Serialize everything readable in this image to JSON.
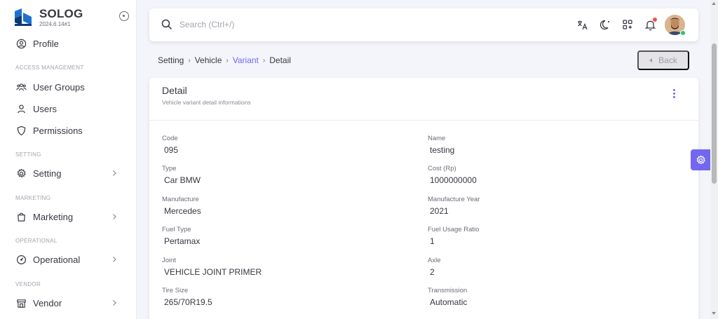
{
  "brand": {
    "name": "SOLOG",
    "version": "2024.6.14#1"
  },
  "sidebar": {
    "profile": "Profile",
    "sections": {
      "access": "ACCESS MANAGEMENT",
      "setting": "SETTING",
      "marketing": "MARKETING",
      "operational": "OPERATIONAL",
      "vendor": "VENDOR"
    },
    "items": {
      "user_groups": "User Groups",
      "users": "Users",
      "permissions": "Permissions",
      "setting": "Setting",
      "marketing": "Marketing",
      "operational": "Operational",
      "vendor": "Vendor"
    }
  },
  "topbar": {
    "search_placeholder": "Search (Ctrl+/)",
    "icons": [
      "translate-icon",
      "theme-toggle-icon",
      "shortcuts-icon",
      "notification-icon"
    ]
  },
  "breadcrumb": [
    "Setting",
    "Vehicle",
    "Variant",
    "Detail"
  ],
  "back_label": "Back",
  "card": {
    "title": "Detail",
    "subtitle": "Vehicle variant detail informations"
  },
  "fields": [
    {
      "label": "Code",
      "value": "095"
    },
    {
      "label": "Name",
      "value": "testing"
    },
    {
      "label": "Type",
      "value": "Car BMW"
    },
    {
      "label": "Cost (Rp)",
      "value": "1000000000"
    },
    {
      "label": "Manufacture",
      "value": "Mercedes"
    },
    {
      "label": "Manufacture Year",
      "value": "2021"
    },
    {
      "label": "Fuel Type",
      "value": "Pertamax"
    },
    {
      "label": "Fuel Usage Ratio",
      "value": "1"
    },
    {
      "label": "Joint",
      "value": "VEHICLE JOINT PRIMER"
    },
    {
      "label": "Axle",
      "value": "2"
    },
    {
      "label": "Tire Size",
      "value": "265/70R19.5"
    },
    {
      "label": "Transmission",
      "value": "Automatic"
    }
  ],
  "colors": {
    "primary": "#7367f0",
    "brand_blue": "#0d6efd",
    "online": "#28c76f",
    "alert": "#ea5455"
  }
}
